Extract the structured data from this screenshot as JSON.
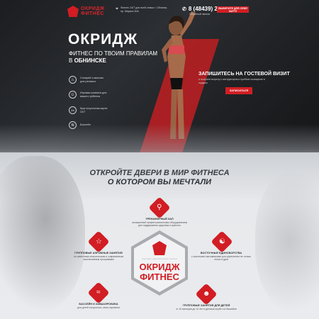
{
  "header": {
    "logo": {
      "line1": "ОКРИДЖ",
      "line2": "ФИТНЕС"
    },
    "address": "Фитнес 24/7 для всей семьи г. Обнинск, пр. Маркса 30А",
    "phone": "8 (48439) 20-777",
    "callback": "Обратный звонок",
    "cta": "ВЫБЕРИТЕ ДЛЯ СЕБЯ КАРТУ"
  },
  "hero": {
    "title": "ОКРИДЖ",
    "subtitle_line1": "ФИТНЕС ПО ТВОИМ ПРАВИЛАМ",
    "subtitle_line2_prefix": "В",
    "subtitle_city": "ОБНИНСКЕ",
    "features": [
      {
        "icon": "steam-icon",
        "text": "Солярий и массаж для релакса"
      },
      {
        "icon": "child-icon",
        "text": "Игровая комната для вашего ребенка"
      },
      {
        "icon": "24-7-icon",
        "text": "Круглосуточная карта 24/7"
      },
      {
        "icon": "pool-icon",
        "text": "Бассейн"
      }
    ],
    "promo": {
      "title": "ЗАПИШИТЕСЬ НА ГОСТЕВОЙ ВИЗИТ",
      "desc": "и получите встречу с инструктором и пробное посещение в подарок",
      "button": "ЗАПИСАТЬСЯ"
    }
  },
  "section": {
    "title_line1": "ОТКРОЙТЕ ДВЕРИ В МИР ФИТНЕСА",
    "title_line2": "О КОТОРОМ ВЫ МЕЧТАЛИ",
    "services": [
      {
        "icon": "dumbbell-icon",
        "title": "ТРЕНАЖЕРНЫЙ ЗАЛ",
        "desc": "оснащенный профессиональным оборудованием для поддержания здоровья и красоты"
      },
      {
        "icon": "aerobics-icon",
        "title": "ГРУППОВЫЕ АЭРОБНЫЕ ЗАНЯТИЯ",
        "desc": "по известным классическим и современным эксклюзивным программам"
      },
      {
        "icon": "martial-arts-icon",
        "title": "ВОСТОЧНЫЕ ЕДИНОБОРСТВА",
        "desc": "с опытными наставниками для укрепления не только тельа и духа"
      },
      {
        "icon": "swimming-icon",
        "title": "БАССЕЙН И АКВААЭРОБИКА",
        "desc": "для детей и взрослых, много времени"
      },
      {
        "icon": "kids-icon",
        "title": "ГРУППОВЫЕ ЗАНЯТИЯ ДЛЯ ДЕТЕЙ",
        "desc": "от 10 месяцев до 14 лет в детском клубе и в бассейне"
      }
    ],
    "center": {
      "tagline": "спортивно-оздоровительный комплекс",
      "brand1": "ОКРИДЖ",
      "brand2": "ФИТНЕС"
    }
  },
  "colors": {
    "accent": "#d11d23",
    "dark": "#1f2124",
    "light": "#e7e9ec"
  }
}
